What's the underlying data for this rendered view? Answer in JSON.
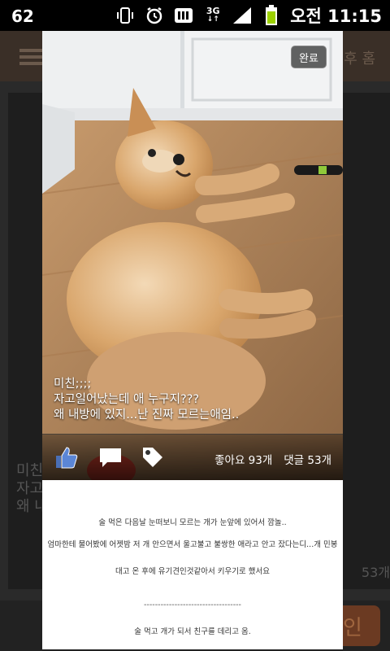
{
  "status": {
    "left_text": "62",
    "network": "3G",
    "time": "오전 11:15",
    "colors": {
      "battery": "#9cd100"
    }
  },
  "background_app": {
    "header_right": "후 홈",
    "card_text": [
      "미친",
      "자고",
      "왜 내"
    ],
    "right_count": "53개",
    "button_label": "인"
  },
  "modal": {
    "done_button": "완료",
    "caption": [
      "미친;;;;",
      "자고일어났는데 애 누구지???",
      "왜 내방에 있지...난 진짜 모르는애임.."
    ],
    "likes": "좋아요 93개",
    "comments": "댓글 53개",
    "body_lines": [
      "술 먹은 다음날 눈떠보니 모르는 개가 눈앞에 있어서 깜놀..",
      "엄마한테 물어봤에 어젯밤 저 개 안으면서 울고불고 불쌍한 애라고 안고 잤다는디...개 민봉",
      "대고 온 후에 유기견인것같아서 키우기로 했서요",
      "-----------------------------------",
      "술 먹고 개가 되서 친구를 데리고 옴."
    ],
    "icons": [
      "like-thumb-icon",
      "comment-bubble-icon",
      "tag-icon"
    ]
  }
}
